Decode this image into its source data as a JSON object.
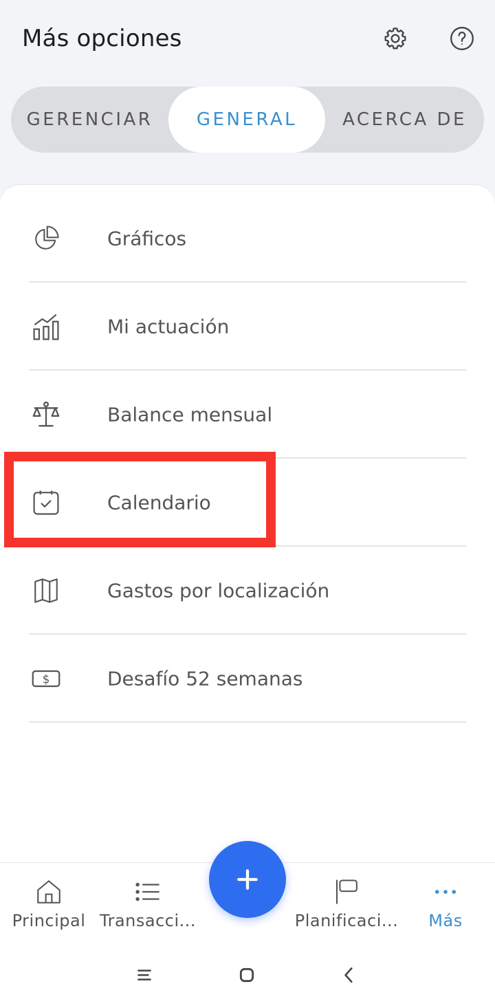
{
  "header": {
    "title": "Más opciones",
    "settings_icon": "gear-icon",
    "help_icon": "question-circle-icon"
  },
  "tabs": [
    {
      "label": "GERENCIAR",
      "selected": false
    },
    {
      "label": "GENERAL",
      "selected": true
    },
    {
      "label": "ACERCA DE",
      "selected": false
    }
  ],
  "menu": {
    "items": [
      {
        "label": "Gráficos",
        "icon": "pie-chart-icon"
      },
      {
        "label": "Mi actuación",
        "icon": "bar-chart-trend-icon"
      },
      {
        "label": "Balance mensual",
        "icon": "scale-icon"
      },
      {
        "label": "Calendario",
        "icon": "calendar-check-icon",
        "highlighted": true
      },
      {
        "label": "Gastos por localización",
        "icon": "map-icon"
      },
      {
        "label": "Desafío 52 semanas",
        "icon": "dollar-bill-icon"
      }
    ]
  },
  "bottom_nav": {
    "items": [
      {
        "label": "Principal",
        "icon": "home-icon",
        "active": false
      },
      {
        "label": "Transacci...",
        "icon": "list-icon",
        "active": false
      },
      {
        "label": "Planificaci...",
        "icon": "flag-icon",
        "active": false
      },
      {
        "label": "Más",
        "icon": "more-dots-icon",
        "active": true
      }
    ],
    "fab_icon": "plus-icon"
  },
  "colors": {
    "accent": "#3a8fd0",
    "fab": "#2f6df0",
    "highlight": "#f5352b",
    "background": "#f2f4f8"
  }
}
